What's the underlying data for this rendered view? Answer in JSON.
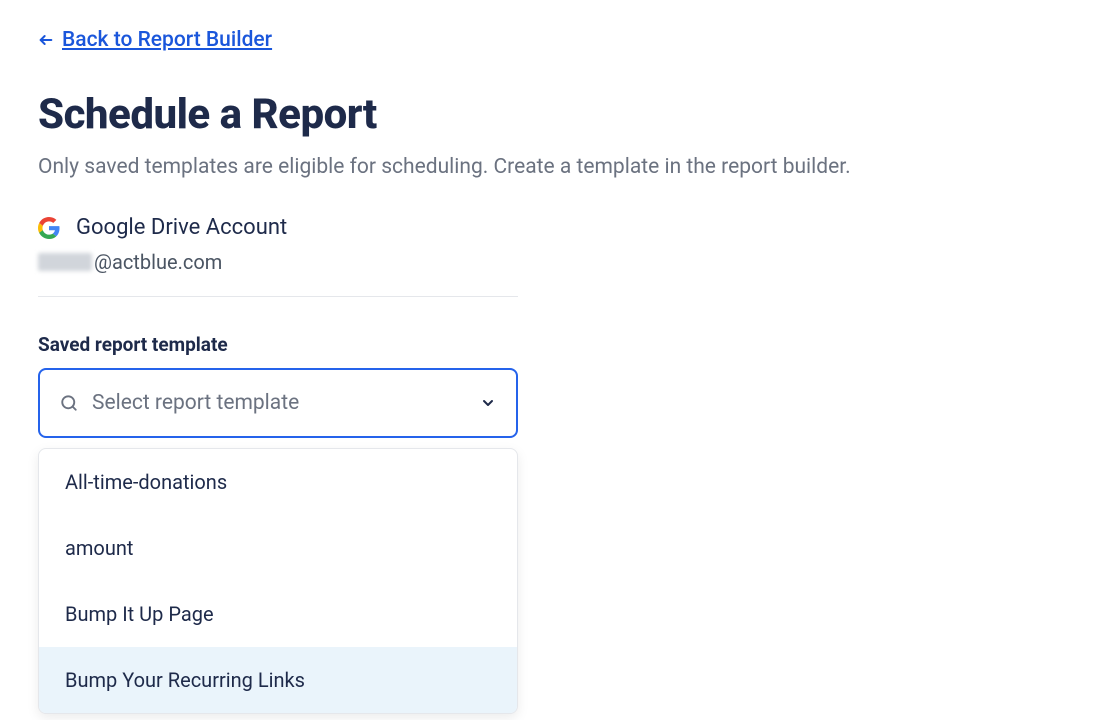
{
  "back_link": {
    "label": "Back to Report Builder"
  },
  "page": {
    "title": "Schedule a Report",
    "subtitle": "Only saved templates are eligible for scheduling. Create a template in the report builder."
  },
  "account": {
    "label": "Google Drive Account",
    "email_domain": "@actblue.com"
  },
  "template_select": {
    "label": "Saved report template",
    "placeholder": "Select report template",
    "options": [
      {
        "label": "All-time-donations",
        "highlighted": false
      },
      {
        "label": "amount",
        "highlighted": false
      },
      {
        "label": "Bump It Up Page",
        "highlighted": false
      },
      {
        "label": "Bump Your Recurring Links",
        "highlighted": true
      }
    ]
  }
}
